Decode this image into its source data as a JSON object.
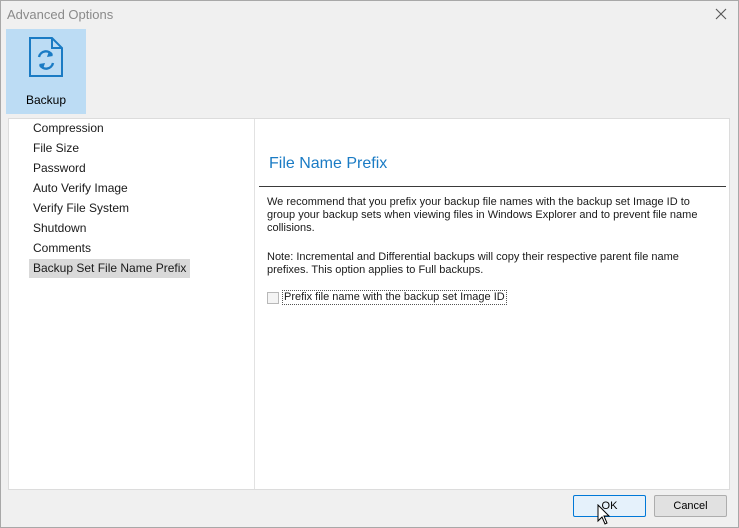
{
  "window": {
    "title": "Advanced Options"
  },
  "ribbon": {
    "items": [
      {
        "label": "Backup",
        "icon": "backup-file-icon"
      }
    ]
  },
  "sidebar": {
    "items": [
      {
        "label": "Compression"
      },
      {
        "label": "File Size"
      },
      {
        "label": "Password"
      },
      {
        "label": "Auto Verify Image"
      },
      {
        "label": "Verify File System"
      },
      {
        "label": "Shutdown"
      },
      {
        "label": "Comments"
      },
      {
        "label": "Backup Set File Name Prefix",
        "selected": true
      }
    ]
  },
  "panel": {
    "title": "File Name Prefix",
    "description": "We recommend that you prefix your backup file names with the backup set Image ID to group your backup sets when viewing files in Windows Explorer and to prevent file name collisions.",
    "note": "Note: Incremental and Differential backups will copy their respective parent file name prefixes. This option applies to Full backups.",
    "checkbox_label": "Prefix file name with the backup set Image ID",
    "checkbox_checked": false
  },
  "buttons": {
    "ok": "OK",
    "cancel": "Cancel"
  },
  "colors": {
    "accent": "#1a7bc4",
    "ribbon_selected": "#bcdcf4",
    "selected_item": "#d9d9d9"
  }
}
